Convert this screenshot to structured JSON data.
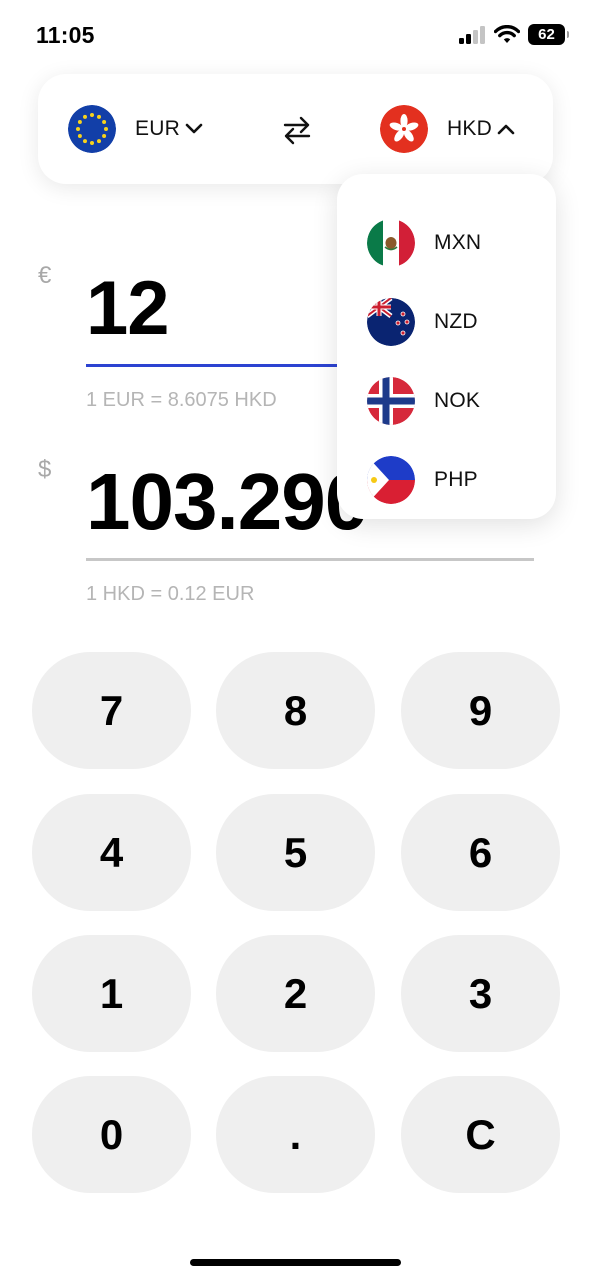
{
  "status_bar": {
    "time": "11:05",
    "battery": "62"
  },
  "selector": {
    "from": {
      "code": "EUR",
      "flag": "eu-flag-icon",
      "dropdown_state": "collapsed"
    },
    "to": {
      "code": "HKD",
      "flag": "hk-flag-icon",
      "dropdown_state": "expanded"
    },
    "swap_icon": "swap-arrows-icon"
  },
  "converter": {
    "from_symbol": "€",
    "from_amount": "12",
    "from_rate": "1 EUR = 8.6075 HKD",
    "to_symbol": "$",
    "to_amount": "103.290",
    "to_rate": "1 HKD = 0.12 EUR",
    "active_color": "#2c43d1"
  },
  "dropdown": {
    "items": [
      {
        "code": "MXN",
        "flag": "mx-flag-icon"
      },
      {
        "code": "NZD",
        "flag": "nz-flag-icon"
      },
      {
        "code": "NOK",
        "flag": "no-flag-icon"
      },
      {
        "code": "PHP",
        "flag": "ph-flag-icon"
      }
    ]
  },
  "keypad": {
    "keys": [
      "7",
      "8",
      "9",
      "4",
      "5",
      "6",
      "1",
      "2",
      "3",
      "0",
      ".",
      "C"
    ]
  }
}
